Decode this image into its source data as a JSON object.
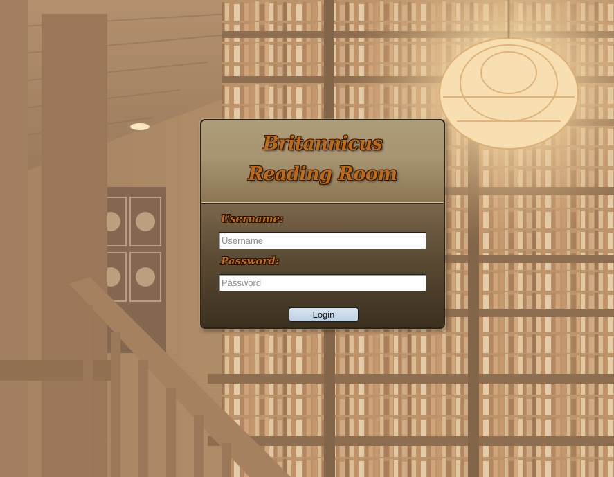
{
  "login": {
    "title_line1": "Britannicus",
    "title_line2": "Reading Room",
    "username_label": "Username:",
    "username_placeholder": "Username",
    "username_value": "",
    "password_label": "Password:",
    "password_placeholder": "Password",
    "password_value": "",
    "login_button_label": "Login"
  },
  "colors": {
    "title_text": "#c06a14",
    "label_text": "#c46c17",
    "header_bg": "#a89470",
    "body_bg": "#5a4a33",
    "button_bg": "#c7d8ea"
  },
  "background": {
    "scene": "library-interior-photo"
  }
}
